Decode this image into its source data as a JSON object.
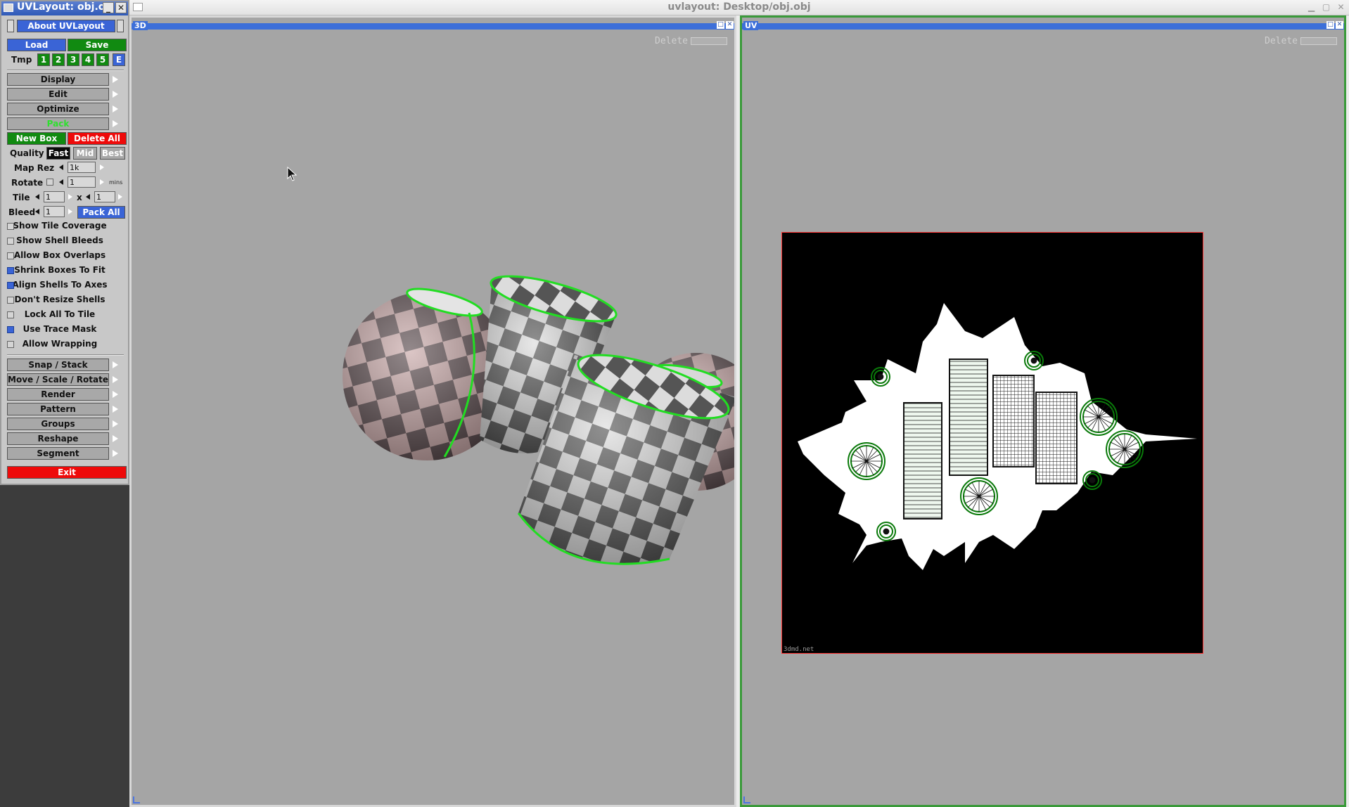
{
  "window": {
    "title": "uvlayout: Desktop/obj.obj"
  },
  "tool_panel": {
    "title": "UVLayout: obj.o",
    "about": "About UVLayout",
    "load": "Load",
    "save": "Save",
    "tmp_label": "Tmp",
    "tmp_slots": [
      "1",
      "2",
      "3",
      "4",
      "5",
      "E"
    ],
    "menus_top": [
      "Display",
      "Edit",
      "Optimize",
      "Pack"
    ],
    "new_box": "New Box",
    "delete_all": "Delete All",
    "quality_label": "Quality",
    "quality_options": [
      "Fast",
      "Mid",
      "Best"
    ],
    "quality_selected": "Fast",
    "map_rez_label": "Map Rez",
    "map_rez_value": "1k",
    "rotate_label": "Rotate",
    "rotate_value": "1",
    "rotate_unit": "mins",
    "tile_label": "Tile",
    "tile_x": "1",
    "tile_sep": "x",
    "tile_y": "1",
    "bleed_label": "Bleed",
    "bleed_value": "1",
    "pack_all": "Pack All",
    "options": [
      {
        "label": "Show Tile Coverage",
        "checked": false
      },
      {
        "label": "Show Shell Bleeds",
        "checked": false
      },
      {
        "label": "Allow Box Overlaps",
        "checked": false
      },
      {
        "label": "Shrink Boxes To Fit",
        "checked": true
      },
      {
        "label": "Align Shells To Axes",
        "checked": true
      },
      {
        "label": "Don't Resize Shells",
        "checked": false
      },
      {
        "label": "Lock All To Tile",
        "checked": false
      },
      {
        "label": "Use Trace Mask",
        "checked": true
      },
      {
        "label": "Allow Wrapping",
        "checked": false
      }
    ],
    "menus_bottom": [
      "Snap / Stack",
      "Move / Scale / Rotate",
      "Render",
      "Pattern",
      "Groups",
      "Reshape",
      "Segment"
    ],
    "exit": "Exit"
  },
  "view_3d": {
    "label": "3D",
    "delete_label": "Delete"
  },
  "view_uv": {
    "label": "UV",
    "delete_label": "Delete",
    "watermark": "3dmd.net"
  },
  "colors": {
    "accent": "#3d6fd9",
    "shell_outline": "#22dd22",
    "exit_red": "#ee0a0a"
  }
}
